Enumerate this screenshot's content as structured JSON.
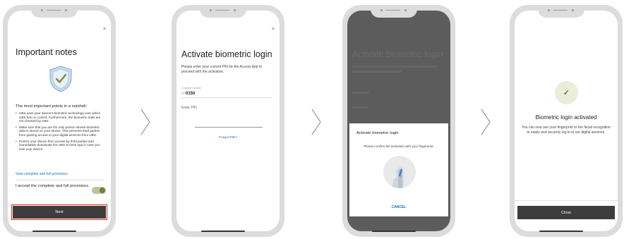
{
  "screen1": {
    "close_icon": "×",
    "title": "Important notes",
    "heading": "The most important points in a nutshell:",
    "bullets": [
      "UBS uses your device's biometric technology over which UBS has no control. Furthermore, the biometric traits are not checked by UBS.",
      "Make sure that you are the only person whose biometric data is stored on your device. This prevents third parties from gaining access to your digital services from UBS.",
      "Protect your device from access by third parties and immediately deactivate the UBS Access App in case you lose your device."
    ],
    "provisions_link": "View complete and full provisions",
    "accept_label": "I accept the complete and full provisions.",
    "toggle_on": true,
    "next_button": "Next"
  },
  "screen2": {
    "close_icon": "×",
    "title": "Activate biometric login",
    "description": "Please enter your current PIN for the Access App to proceed with the activation.",
    "contract_label": "Contract number",
    "contract_value": "···0150",
    "pin_label": "Enter PIN",
    "forgot_link": "Forgot PIN?"
  },
  "screen3": {
    "dialog_title": "Activate biometric login",
    "dialog_description": "Please confirm the activation with your fingerprint.",
    "cancel_button": "CANCEL"
  },
  "screen4": {
    "check_icon": "✓",
    "title": "Biometric login activated",
    "description": "You can now use your fingerprint or the facial recognition to easily and securely log in to our digital services.",
    "close_button": "Close"
  },
  "icons": {
    "shield": "shield-check-icon",
    "fingerprint": "fingerprint-icon",
    "arrow": "chevron-right-icon"
  },
  "colors": {
    "accent_link": "#1c6fb5",
    "button_dark": "#3d3d3d",
    "highlight_red": "#e1261c",
    "toggle_green": "#727f3b"
  }
}
